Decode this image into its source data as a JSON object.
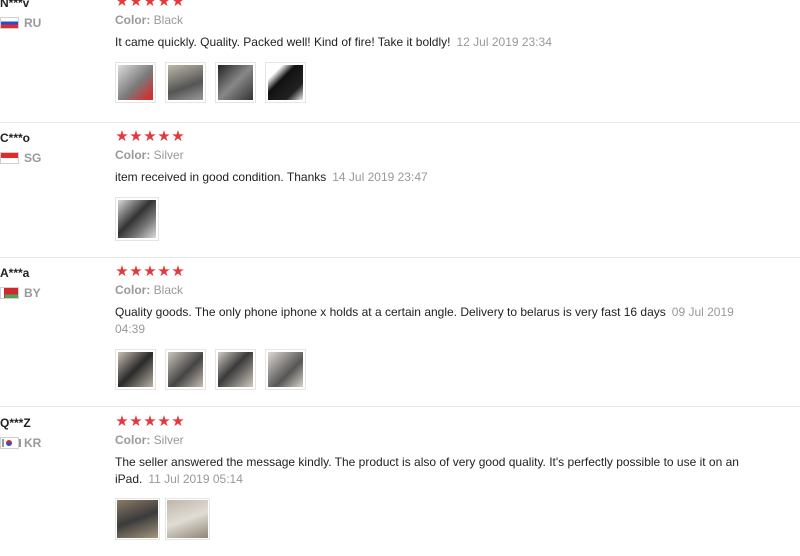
{
  "reviews": [
    {
      "user": "N***v",
      "country": "RU",
      "color_label": "Color:",
      "color_value": "Black",
      "text": "It came quickly. Quality. Packed well! Kind of fire! Take it boldly!",
      "date": "12 Jul 2019 23:34",
      "stars": 5,
      "photos": [
        {
          "name": "photo-stand-box",
          "bg": "linear-gradient(135deg,#dcdcdc,#7a7a7a 55%,#c33 90%)"
        },
        {
          "name": "photo-stand-angled",
          "bg": "linear-gradient(160deg,#bfb8aa,#555 60%,#9a9a9a)"
        },
        {
          "name": "photo-stand-dark",
          "bg": "linear-gradient(135deg,#222,#888 50%,#333)"
        },
        {
          "name": "photo-stand-black",
          "bg": "linear-gradient(135deg,#fff 20%,#111 40%,#222 75%,#eee)"
        }
      ]
    },
    {
      "user": "C***o",
      "country": "SG",
      "color_label": "Color:",
      "color_value": "Silver",
      "text": "item received in good condition. Thanks",
      "date": "14 Jul 2019 23:47",
      "stars": 5,
      "photos": [
        {
          "name": "photo-silver-stand",
          "bg": "linear-gradient(135deg,#d8d8d8,#333 45%,#777 70%,#ddd)"
        }
      ]
    },
    {
      "user": "A***a",
      "country": "BY",
      "color_label": "Color:",
      "color_value": "Black",
      "text": "Quality goods. The only phone iphone x holds at a certain angle. Delivery to belarus is very fast 16 days",
      "date": "09 Jul 2019 04:39",
      "stars": 5,
      "photos": [
        {
          "name": "photo-black-stand-1",
          "bg": "linear-gradient(135deg,#c9c0b4,#2a2a2a 50%,#b8afa3)"
        },
        {
          "name": "photo-black-stand-2",
          "bg": "linear-gradient(135deg,#cdc6bc,#444 55%,#c4bcb2)"
        },
        {
          "name": "photo-black-stand-3",
          "bg": "linear-gradient(135deg,#d2ccc4,#3a3a3a 45%,#cfc8bf)"
        },
        {
          "name": "photo-black-stand-4",
          "bg": "linear-gradient(135deg,#ddd8d2,#555 60%,#d8d2cb)"
        }
      ]
    },
    {
      "user": "Q***Z",
      "country": "KR",
      "color_label": "Color:",
      "color_value": "Silver",
      "text": "The seller answered the message kindly. The product is also of very good quality. It's perfectly possible to use it on an iPad.",
      "date": "11 Jul 2019 05:14",
      "stars": 5,
      "photos": [
        {
          "name": "photo-ipad-stand",
          "bg": "linear-gradient(160deg,#8a7a66,#3b3b3b 50%,#a5967f)"
        },
        {
          "name": "photo-silver-stand-desk",
          "bg": "linear-gradient(160deg,#bfb6a8,#e0dcd5 50%,#8f8575)"
        }
      ]
    }
  ]
}
